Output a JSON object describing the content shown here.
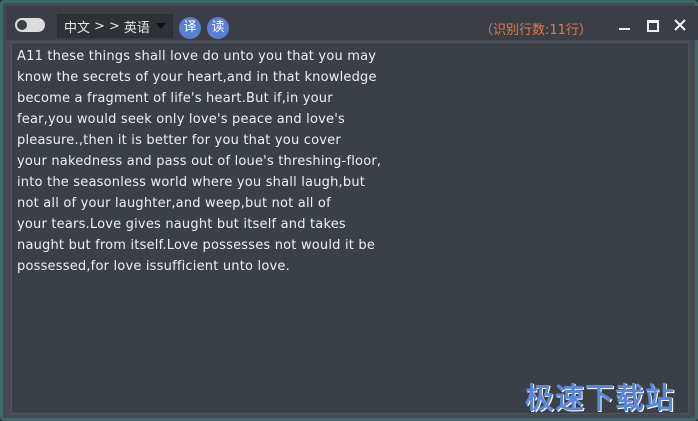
{
  "titlebar": {
    "source_lang": "中文",
    "arrow1": ">",
    "arrow2": ">",
    "target_lang": "英语",
    "translate_label": "译",
    "read_label": "读",
    "line_count_text": "（识别行数:11行）"
  },
  "content": {
    "lines": [
      "A11 these things shall love do unto you that you may",
      "know the secrets of your heart,and in that knowledge",
      "become a fragment of life's heart.But if,in your",
      "fear,you would seek only love's peace and love's",
      "pleasure.,then it is better for you that you cover",
      "your nakedness and pass out of loue's threshing-floor,",
      "into the seasonless world where you shall laugh,but",
      "not all of your laughter,and weep,but not all of",
      "your tears.Love gives naught but itself and takes",
      "naught but from itself.Love possesses not would it be",
      "possessed,for love issufficient unto love."
    ]
  },
  "watermark": "极速下载站",
  "colors": {
    "border": "#3d6a68",
    "titlebar": "#3b3f45",
    "content_bg": "#3b3f46",
    "accent_button": "#5b7fd6",
    "line_count": "#e07a4a",
    "watermark": "#5b87d6"
  },
  "icons": {
    "toggle": "toggle-switch-icon",
    "dropdown": "chevron-down-icon",
    "minimize": "minimize-icon",
    "maximize": "maximize-icon",
    "close": "close-icon"
  }
}
